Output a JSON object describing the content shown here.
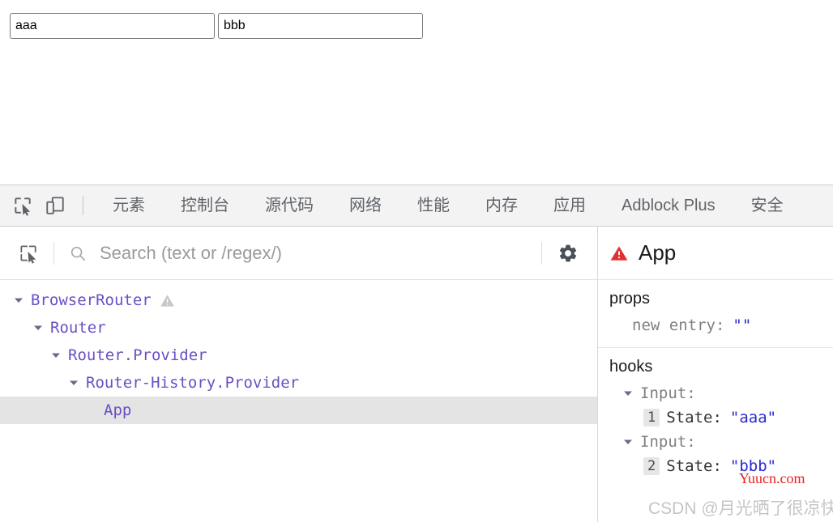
{
  "page": {
    "inputs": [
      {
        "name": "input-aaa",
        "value": "aaa",
        "placeholder": ""
      },
      {
        "name": "input-bbb",
        "value": "bbb",
        "placeholder": ""
      }
    ]
  },
  "devtools": {
    "toolbar_icons": [
      {
        "name": "inspect-element-icon",
        "label": "Inspect element"
      },
      {
        "name": "device-toolbar-icon",
        "label": "Toggle device toolbar"
      }
    ],
    "tabs": [
      {
        "label": "元素",
        "active": false
      },
      {
        "label": "控制台",
        "active": false
      },
      {
        "label": "源代码",
        "active": false
      },
      {
        "label": "网络",
        "active": false
      },
      {
        "label": "性能",
        "active": false
      },
      {
        "label": "内存",
        "active": false
      },
      {
        "label": "应用",
        "active": false
      },
      {
        "label": "Adblock Plus",
        "active": false
      },
      {
        "label": "安全",
        "active": false
      }
    ]
  },
  "react_devtools": {
    "search": {
      "placeholder": "Search (text or /regex/)",
      "value": ""
    },
    "icons": {
      "inspect": "select-component-icon",
      "search": "search-icon",
      "settings": "gear-icon"
    },
    "tree": [
      {
        "label": "BrowserRouter",
        "depth": 0,
        "expanded": true,
        "warning": true,
        "selected": false
      },
      {
        "label": "Router",
        "depth": 1,
        "expanded": true,
        "warning": false,
        "selected": false
      },
      {
        "label": "Router.Provider",
        "depth": 2,
        "expanded": true,
        "warning": false,
        "selected": false
      },
      {
        "label": "Router-History.Provider",
        "depth": 3,
        "expanded": true,
        "warning": false,
        "selected": false
      },
      {
        "label": "App",
        "depth": 4,
        "expanded": false,
        "warning": false,
        "selected": true
      }
    ],
    "inspector": {
      "badge": "error-warning-icon",
      "title": "App",
      "props_section": {
        "title": "props",
        "rows": [
          {
            "key": "new entry:",
            "value": "\"\""
          }
        ]
      },
      "hooks_section": {
        "title": "hooks",
        "hooks": [
          {
            "name": "Input:",
            "expanded": true,
            "index": "1",
            "state_key": "State:",
            "state_value": "\"aaa\""
          },
          {
            "name": "Input:",
            "expanded": true,
            "index": "2",
            "state_key": "State:",
            "state_value": "\"bbb\""
          }
        ]
      }
    }
  },
  "watermarks": {
    "primary": "Yuucn.com",
    "secondary": "CSDN @月光晒了很凉快"
  },
  "colors": {
    "tree_text": "#6a4fc4",
    "value_blue": "#2a2ad0",
    "error_red": "#e03131",
    "warning_gray": "#c8c8c8",
    "selected_row": "#e4e4e4",
    "tabbar_bg": "#f3f3f3",
    "watermark_red": "#e8201f"
  }
}
